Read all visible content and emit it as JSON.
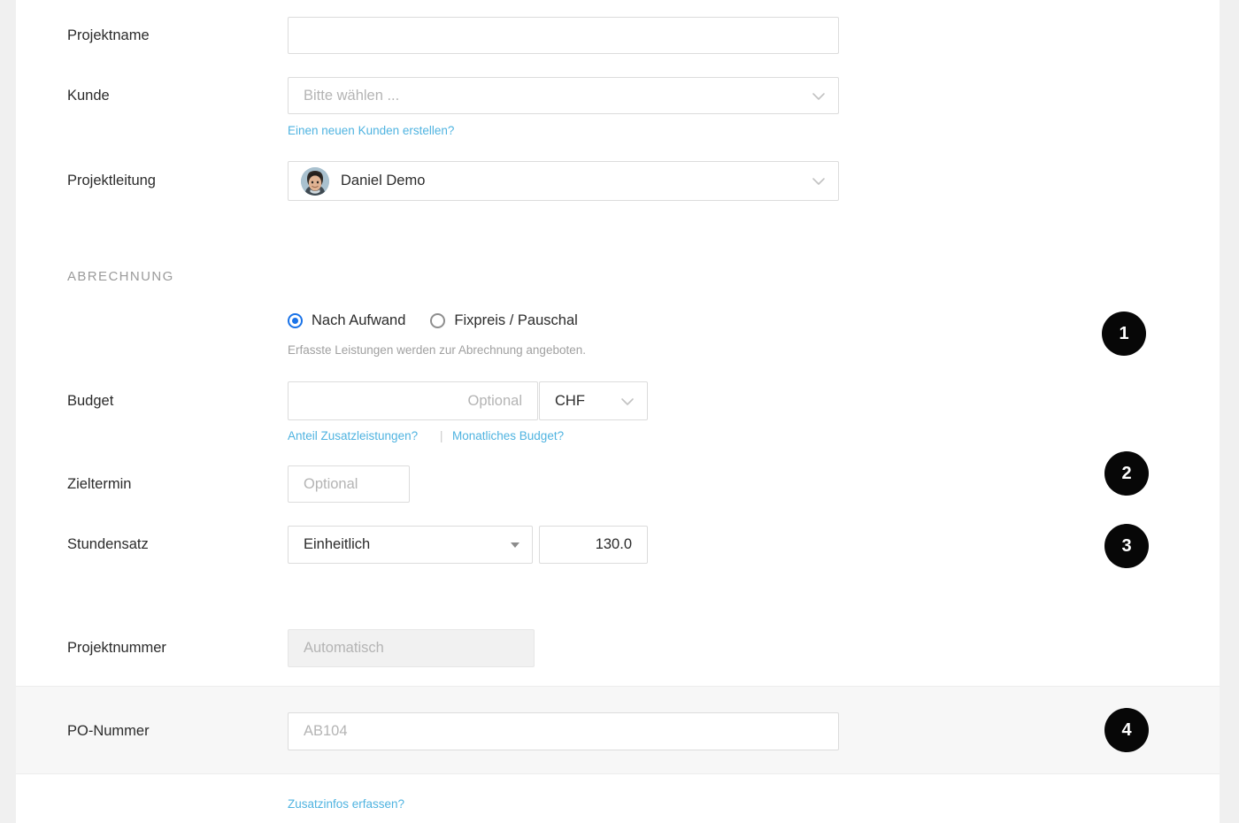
{
  "theme": {
    "panel_bg": "#ffffff",
    "page_bg": "#f0f0f0",
    "band_bg": "#f7f7f7",
    "link_color": "#4fb3e0",
    "radio_accent": "#1a73e8",
    "badge_bg": "#070707",
    "text_color": "#2b2b2b",
    "muted_color": "#a0a0a0"
  },
  "form": {
    "fields": {
      "projektname": {
        "label": "Projektname",
        "value": "",
        "placeholder": ""
      },
      "kunde": {
        "label": "Kunde",
        "value": "",
        "placeholder": "Bitte wählen ...",
        "link": "Einen neuen Kunden erstellen?"
      },
      "projektleitung": {
        "label": "Projektleitung",
        "value": "Daniel Demo",
        "avatar_name": "user-avatar"
      },
      "budget": {
        "label": "Budget",
        "value": "",
        "placeholder": "Optional",
        "currency": "CHF"
      },
      "zieltermin": {
        "label": "Zieltermin",
        "value": "",
        "placeholder": "Optional"
      },
      "stundensatz": {
        "label": "Stundensatz",
        "mode": "Einheitlich",
        "rate": "130.0"
      },
      "projektnummer": {
        "label": "Projektnummer",
        "value": "",
        "placeholder": "Automatisch",
        "disabled": true
      },
      "ponummer": {
        "label": "PO-Nummer",
        "value": "",
        "placeholder": "AB104"
      }
    },
    "section_abrechnung": {
      "title": "ABRECHNUNG",
      "options": [
        {
          "label": "Nach Aufwand",
          "selected": true
        },
        {
          "label": "Fixpreis / Pauschal",
          "selected": false
        }
      ],
      "helper": "Erfasste Leistungen werden zur Abrechnung angeboten."
    },
    "links": {
      "neuer_kunde": "Einen neuen Kunden erstellen?",
      "anteil_zusatzleistungen": "Anteil Zusatzleistungen?",
      "link_separator": "|",
      "monatliches_budget": "Monatliches Budget?",
      "zusatzinfos": "Zusatzinfos erfassen?"
    }
  },
  "annotations": {
    "badges": [
      {
        "number": "1"
      },
      {
        "number": "2"
      },
      {
        "number": "3"
      },
      {
        "number": "4"
      }
    ]
  }
}
